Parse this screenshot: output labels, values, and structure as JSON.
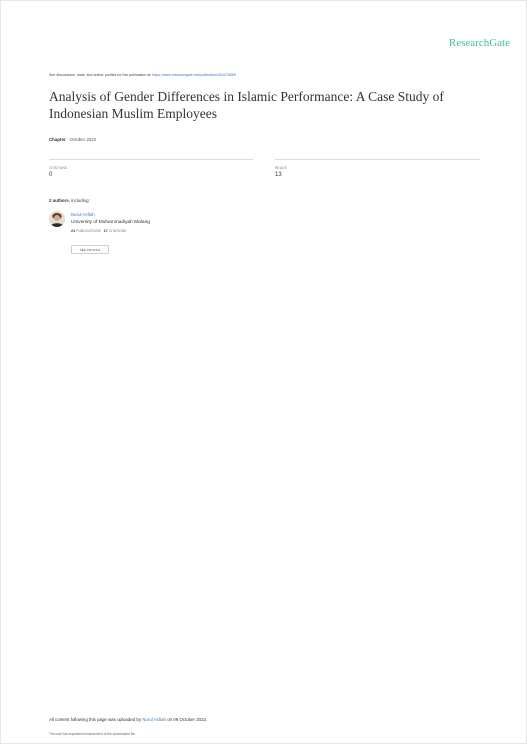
{
  "brand": {
    "name": "ResearchGate",
    "color": "#40ba9b"
  },
  "discussion": {
    "text": "See discussions, stats, and author profiles for this publication at:",
    "url": "https://www.researchgate.net/publication/364278869"
  },
  "title": "Analysis of Gender Differences in Islamic Performance: A Case Study of Indonesian Muslim Employees",
  "meta": {
    "type": "Chapter",
    "separator": "·",
    "date": "October 2022"
  },
  "stats": {
    "citations": {
      "label": "CITATIONS",
      "value": "0"
    },
    "reads": {
      "label": "READS",
      "value": "13"
    }
  },
  "authors_heading": {
    "count": "2 authors",
    "suffix": ", including:"
  },
  "author": {
    "name": "Nurul Asfiah",
    "institution": "University of Muhammadiyah Malang",
    "publications_count": "21",
    "publications_label": "PUBLICATIONS",
    "citations_count": "17",
    "citations_label": "CITATIONS",
    "profile_button": "SEE PROFILE"
  },
  "footer": {
    "upload_prefix": "All content following this page was uploaded by",
    "uploader": "Nurul Asfiah",
    "upload_suffix": "on 09 October 2022.",
    "note": "The user has requested enhancement of the downloaded file."
  },
  "colors": {
    "link": "#3d78c0",
    "text": "#333333",
    "muted": "#777777"
  }
}
